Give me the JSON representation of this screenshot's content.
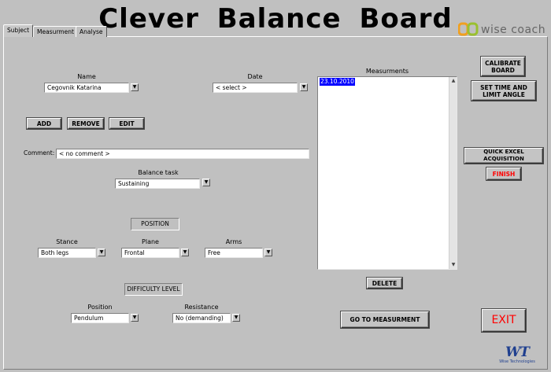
{
  "app": {
    "title": "Clever Balance Board",
    "logo_text": "wise coach"
  },
  "tabs": [
    {
      "label": "Subject",
      "active": true
    },
    {
      "label": "Measurment",
      "active": false
    },
    {
      "label": "Analyse",
      "active": false
    }
  ],
  "subject": {
    "name_label": "Name",
    "name_value": "Cegovnik Katarina",
    "date_label": "Date",
    "date_value": "< select >",
    "add_label": "ADD",
    "remove_label": "REMOVE",
    "edit_label": "EDIT",
    "comment_label": "Comment:",
    "comment_value": "< no comment >",
    "balance_task_label": "Balance task",
    "balance_task_value": "Sustaining",
    "position_header": "POSITION",
    "stance_label": "Stance",
    "stance_value": "Both legs",
    "plane_label": "Plane",
    "plane_value": "Frontal",
    "arms_label": "Arms",
    "arms_value": "Free",
    "difficulty_header": "DIFFICULTY LEVEL",
    "position_label": "Position",
    "position_value": "Pendulum",
    "resistance_label": "Resistance",
    "resistance_value": "No (demanding)"
  },
  "measurements": {
    "label": "Measurments",
    "items": [
      "23.10.2010"
    ],
    "delete_label": "DELETE",
    "go_label": "GO TO MEASURMENT"
  },
  "controls": {
    "calibrate_line1": "CALIBRATE",
    "calibrate_line2": "BOARD",
    "settime_line1": "SET TIME  AND",
    "settime_line2": "LIMIT ANGLE",
    "quick_excel_label": "QUICK EXCEL ACQUISITION",
    "finish_label": "FINISH",
    "exit_label": "EXIT"
  },
  "footer": {
    "logo_mark": "WT",
    "logo_line1": "Wise Technologies"
  },
  "colors": {
    "background": "#c0c0c0",
    "selection": "#0000ff",
    "finish_text": "#ff0000",
    "exit_text": "#ff0000",
    "logo_orange": "#f0a020",
    "logo_green": "#9ac030",
    "wt_blue": "#1f3f8f"
  }
}
